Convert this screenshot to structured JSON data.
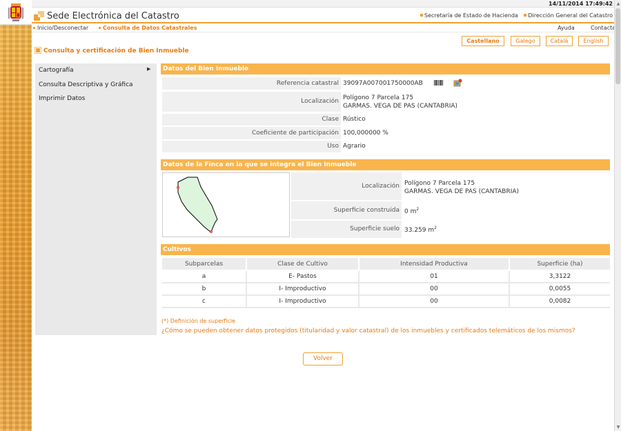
{
  "datetime": "14/11/2014  17:49:42",
  "site_title": "Sede Electrónica del Catastro",
  "header_links": [
    "Secretaría de Estado de Hacienda",
    "Dirección General del Catastro"
  ],
  "nav": {
    "inicio": "Inicio/Desconectar",
    "consulta": "Consulta de Datos Catastrales",
    "ayuda": "Ayuda",
    "contactar": "Contactar"
  },
  "languages": [
    "Castellano",
    "Galego",
    "Català",
    "English"
  ],
  "page_heading": "Consulta y certificación de Bien Inmueble",
  "sidemenu": [
    "Cartografía",
    "Consulta Descriptiva y Gráfica",
    "Imprimir Datos"
  ],
  "bien": {
    "title": "Datos del Bien Inmueble",
    "referencia_label": "Referencia catastral",
    "referencia": "39097A007001750000AB",
    "localizacion_label": "Localización",
    "localizacion_1": "Polígono 7 Parcela 175",
    "localizacion_2": "GARMAS. VEGA DE PAS (CANTABRIA)",
    "clase_label": "Clase",
    "clase": "Rústico",
    "coef_label": "Coeficiente de participación",
    "coef": "100,000000 %",
    "uso_label": "Uso",
    "uso": "Agrario"
  },
  "finca": {
    "title": "Datos de la Finca en la que se integra el Bien Inmueble",
    "localizacion_label": "Localización",
    "localizacion_1": "Polígono 7 Parcela 175",
    "localizacion_2": "GARMAS. VEGA DE PAS (CANTABRIA)",
    "construida_label": "Superficie construida",
    "construida": "0 m",
    "suelo_label": "Superficie suelo",
    "suelo": "33.259 m"
  },
  "cultivos": {
    "title": "Cultivos",
    "headers": [
      "Subparcelas",
      "Clase de Cultivo",
      "Intensidad Productiva",
      "Superficie (ha)"
    ],
    "rows": [
      [
        "a",
        "E- Pastos",
        "01",
        "3,3122"
      ],
      [
        "b",
        "I- Improductivo",
        "00",
        "0,0055"
      ],
      [
        "c",
        "I- Improductivo",
        "00",
        "0,0082"
      ]
    ]
  },
  "note": "(*) Definición de superficie",
  "faq": "¿Cómo se pueden obtener datos protegidos (titularidad y valor catastral) de los inmuebles y certificados telemáticos de los mismos?",
  "volver": "Volver"
}
